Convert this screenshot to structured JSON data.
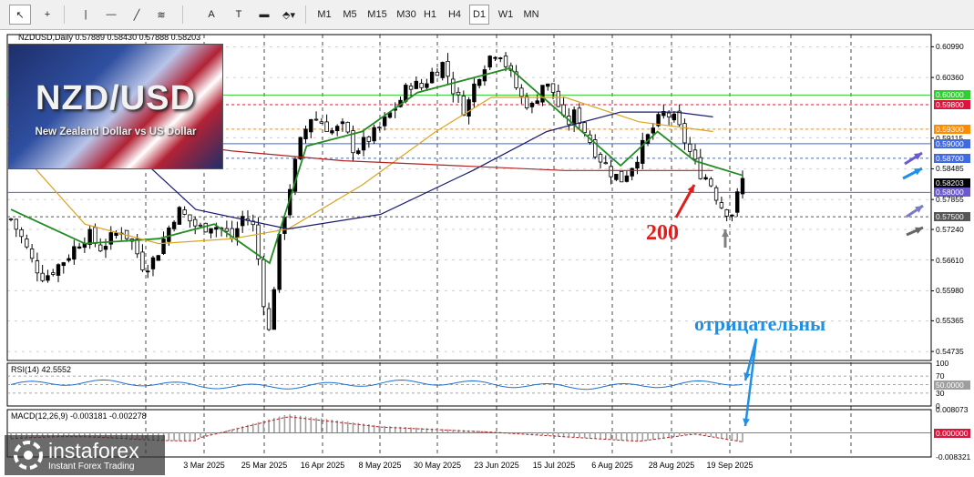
{
  "toolbar": {
    "tools": [
      {
        "name": "cursor-icon",
        "glyph": "↖"
      },
      {
        "name": "crosshair-icon",
        "glyph": "+"
      },
      {
        "name": "vertical-line-icon",
        "glyph": "|"
      },
      {
        "name": "horizontal-line-icon",
        "glyph": "—"
      },
      {
        "name": "trendline-icon",
        "glyph": "╱"
      },
      {
        "name": "fibonacci-icon",
        "glyph": "≋"
      },
      {
        "name": "text-icon",
        "glyph": "A"
      },
      {
        "name": "text-label-icon",
        "glyph": "T"
      },
      {
        "name": "rectangle-icon",
        "glyph": "▬"
      },
      {
        "name": "shapes-icon",
        "glyph": "⬘▾"
      }
    ],
    "timeframes": [
      "M1",
      "M5",
      "M15",
      "M30",
      "H1",
      "H4",
      "D1",
      "W1",
      "MN"
    ],
    "selected_timeframe": "D1"
  },
  "chart": {
    "symbol_header": "NZDUSD,Daily  0.57889 0.58430 0.57888 0.58203",
    "logo_title": "NZD/USD",
    "logo_subtitle": "New Zealand Dollar vs US Dollar",
    "annotation_200": "200",
    "annotation_negative": "отрицательны",
    "colors": {
      "background": "#ffffff",
      "candle_up": "#000000",
      "candle_down": "#ffffff",
      "ma_fast_light": "#90ee90",
      "ma_fast": "#228b22",
      "ma_50": "#daa520",
      "ma_100": "#191970",
      "ma_200": "#b22222",
      "level_green": "#32cd32",
      "level_red": "#dc143c",
      "level_orange": "#ff8c00",
      "level_blue": "#4169e1",
      "arrow_red": "#e01c1c",
      "arrow_blue": "#1e90e6"
    }
  },
  "brand": {
    "name": "instaforex",
    "tagline": "Instant Forex Trading"
  },
  "chart_data": [
    {
      "type": "candlestick",
      "title": "NZDUSD,Daily",
      "ohlc_last": {
        "open": 0.57889,
        "high": 0.5843,
        "low": 0.57888,
        "close": 0.58203
      },
      "x_labels": [
        "3 Mar 2025",
        "25 Mar 2025",
        "16 Apr 2025",
        "8 May 2025",
        "30 May 2025",
        "23 Jun 2025",
        "15 Jul 2025",
        "6 Aug 2025",
        "28 Aug 2025",
        "19 Sep 2025"
      ],
      "y_ticks": [
        "0.60990",
        "0.60360",
        "0.59115",
        "0.58485",
        "0.57855",
        "0.57240",
        "0.56610",
        "0.55980",
        "0.55365",
        "0.54735"
      ],
      "ylim": [
        0.5455,
        0.6124
      ],
      "horizontal_levels": [
        {
          "value": 0.6,
          "label": "0.60000",
          "color": "#32cd32",
          "style": "solid"
        },
        {
          "value": 0.598,
          "label": "0.59800",
          "color": "#dc143c",
          "style": "dashed"
        },
        {
          "value": 0.593,
          "label": "0.59300",
          "color": "#ff8c00",
          "style": "dashed"
        },
        {
          "value": 0.59,
          "label": "0.59000",
          "color": "#4169e1",
          "style": "solid"
        },
        {
          "value": 0.587,
          "label": "0.58700",
          "color": "#4169e1",
          "style": "dashed"
        },
        {
          "value": 0.58203,
          "label": "0.58203",
          "color": "#000000",
          "style": "current"
        },
        {
          "value": 0.58,
          "label": "0.58000",
          "color": "#6a5acd",
          "style": "solid"
        },
        {
          "value": 0.575,
          "label": "0.57500",
          "color": "#555555",
          "style": "dashed"
        }
      ],
      "close_path": [
        [
          0,
          0.5745
        ],
        [
          6,
          0.5705
        ],
        [
          12,
          0.5655
        ],
        [
          18,
          0.5625
        ],
        [
          24,
          0.5645
        ],
        [
          30,
          0.5665
        ],
        [
          36,
          0.5695
        ],
        [
          42,
          0.5715
        ],
        [
          48,
          0.5685
        ],
        [
          54,
          0.5705
        ],
        [
          60,
          0.5725
        ],
        [
          66,
          0.5695
        ],
        [
          72,
          0.5645
        ],
        [
          78,
          0.5665
        ],
        [
          84,
          0.5715
        ],
        [
          90,
          0.5765
        ],
        [
          96,
          0.5745
        ],
        [
          102,
          0.5725
        ],
        [
          108,
          0.5735
        ],
        [
          114,
          0.5725
        ],
        [
          120,
          0.5705
        ],
        [
          126,
          0.5755
        ],
        [
          132,
          0.5725
        ],
        [
          136,
          0.5595
        ],
        [
          140,
          0.5505
        ],
        [
          144,
          0.5675
        ],
        [
          150,
          0.5795
        ],
        [
          156,
          0.5895
        ],
        [
          162,
          0.5955
        ],
        [
          168,
          0.5945
        ],
        [
          174,
          0.5925
        ],
        [
          180,
          0.5935
        ],
        [
          186,
          0.5885
        ],
        [
          192,
          0.5905
        ],
        [
          198,
          0.5925
        ],
        [
          204,
          0.5955
        ],
        [
          210,
          0.5985
        ],
        [
          216,
          0.6025
        ],
        [
          222,
          0.6015
        ],
        [
          228,
          0.6045
        ],
        [
          234,
          0.6065
        ],
        [
          240,
          0.6005
        ],
        [
          246,
          0.5965
        ],
        [
          252,
          0.6035
        ],
        [
          258,
          0.6075
        ],
        [
          264,
          0.6095
        ],
        [
          270,
          0.6045
        ],
        [
          276,
          0.5995
        ],
        [
          282,
          0.5975
        ],
        [
          288,
          0.6025
        ],
        [
          294,
          0.6005
        ],
        [
          300,
          0.5935
        ],
        [
          306,
          0.5965
        ],
        [
          312,
          0.5915
        ],
        [
          318,
          0.5875
        ],
        [
          324,
          0.5845
        ],
        [
          330,
          0.5825
        ],
        [
          336,
          0.5855
        ],
        [
          342,
          0.5895
        ],
        [
          348,
          0.5935
        ],
        [
          354,
          0.5965
        ],
        [
          360,
          0.5945
        ],
        [
          366,
          0.5895
        ],
        [
          372,
          0.5845
        ],
        [
          378,
          0.5825
        ],
        [
          384,
          0.5775
        ],
        [
          390,
          0.5755
        ],
        [
          396,
          0.5825
        ]
      ],
      "series": [
        {
          "name": "MA fast",
          "color": "#228b22",
          "values": [
            [
              0,
              0.5765
            ],
            [
              40,
              0.5695
            ],
            [
              80,
              0.5705
            ],
            [
              110,
              0.5735
            ],
            [
              140,
              0.5655
            ],
            [
              160,
              0.5895
            ],
            [
              190,
              0.5925
            ],
            [
              220,
              0.6005
            ],
            [
              250,
              0.6035
            ],
            [
              270,
              0.6055
            ],
            [
              300,
              0.5955
            ],
            [
              330,
              0.5855
            ],
            [
              350,
              0.5925
            ],
            [
              370,
              0.5865
            ],
            [
              396,
              0.5835
            ]
          ]
        },
        {
          "name": "MA 50",
          "color": "#daa520",
          "values": [
            [
              0,
              0.5905
            ],
            [
              40,
              0.5735
            ],
            [
              80,
              0.5695
            ],
            [
              120,
              0.5705
            ],
            [
              150,
              0.5725
            ],
            [
              190,
              0.5815
            ],
            [
              230,
              0.5925
            ],
            [
              260,
              0.5995
            ],
            [
              300,
              0.5995
            ],
            [
              340,
              0.5945
            ],
            [
              380,
              0.5925
            ]
          ]
        },
        {
          "name": "MA 100",
          "color": "#191970",
          "values": [
            [
              60,
              0.5905
            ],
            [
              100,
              0.5765
            ],
            [
              150,
              0.5725
            ],
            [
              200,
              0.5755
            ],
            [
              250,
              0.5845
            ],
            [
              290,
              0.5925
            ],
            [
              330,
              0.5965
            ],
            [
              360,
              0.5965
            ],
            [
              380,
              0.5955
            ]
          ]
        },
        {
          "name": "MA 200",
          "color": "#b22222",
          "values": [
            [
              0,
              0.5935
            ],
            [
              60,
              0.5915
            ],
            [
              120,
              0.5885
            ],
            [
              180,
              0.5865
            ],
            [
              240,
              0.5855
            ],
            [
              300,
              0.5845
            ],
            [
              350,
              0.5845
            ],
            [
              380,
              0.5845
            ]
          ]
        }
      ]
    },
    {
      "type": "line",
      "title": "RSI(14) 42.5552",
      "y_ticks": [
        "100",
        "70",
        "50",
        "30",
        "0"
      ],
      "levels": [
        70,
        50,
        30
      ],
      "current_label": "50.0000",
      "ylim": [
        0,
        100
      ]
    },
    {
      "type": "bar",
      "title": "MACD(12,26,9) -0.003181 -0.002278",
      "y_ticks": [
        "0.008073",
        "0.000000",
        "-0.008321"
      ],
      "ylim": [
        -0.008321,
        0.008073
      ]
    }
  ]
}
